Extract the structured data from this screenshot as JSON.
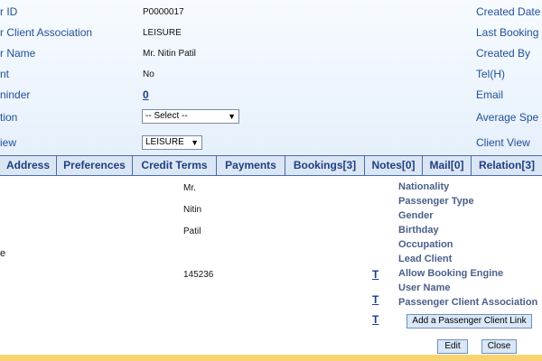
{
  "header": {
    "left_labels": [
      "r ID",
      "r Client Association",
      "r Name",
      "nt",
      "ninder",
      "tion",
      "iew"
    ],
    "values": [
      "P0000017",
      "LEISURE",
      "Mr. Nitin Patil",
      "No"
    ],
    "reminder_count": "0",
    "select_default": "-- Select --",
    "view_select": "LEISURE",
    "right_labels": [
      "Created Date",
      "Last Booking",
      "Created By",
      "Tel(H)",
      "Email",
      "Average Spe",
      "Client View"
    ]
  },
  "tabs": [
    "Address",
    "Preferences",
    "Credit Terms",
    "Payments",
    "Bookings[3]",
    "Notes[0]",
    "Mail[0]",
    "Relation[3]"
  ],
  "content": {
    "left_partial": "e",
    "values": [
      "Mr.",
      "Nitin",
      "Patil",
      "145236"
    ],
    "labels": [
      "Nationality",
      "Passenger Type",
      "Gender",
      "Birthday",
      "Occupation",
      "Lead Client",
      "Allow Booking Engine",
      "User Name",
      "Passenger Client Association"
    ],
    "t_link": "T",
    "add_link_button": "Add a Passenger Client Link"
  },
  "footer": {
    "edit_button": "Edit",
    "close_button": "Close"
  },
  "colors": {
    "label_blue": "#1f4f99",
    "tab_bg": "#dbe6f5",
    "footer_bar": "#f7d470"
  }
}
